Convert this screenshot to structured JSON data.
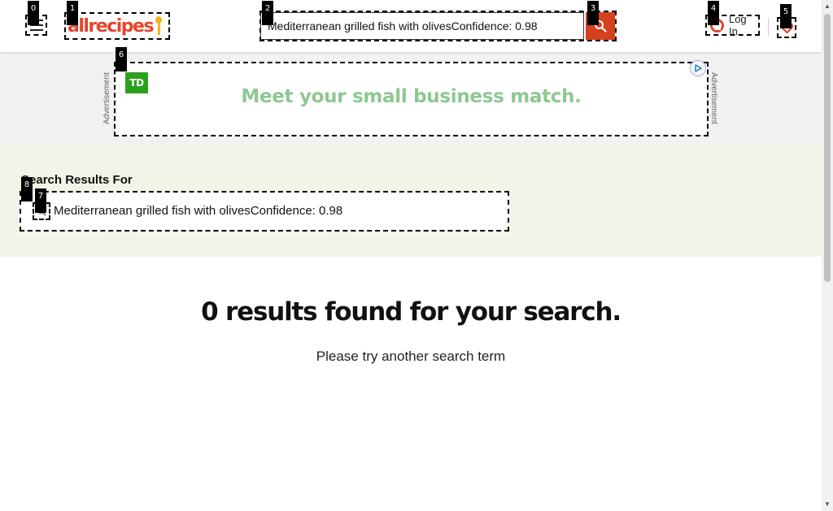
{
  "header": {
    "logo_text": "allrecipes",
    "search_value": "Mediterranean grilled fish with olivesConfidence: 0.98",
    "login_label": "Log In"
  },
  "ad": {
    "label": "Advertisement",
    "brand": "TD",
    "headline": "Meet your small business match."
  },
  "results": {
    "heading": "Search Results For",
    "query": "Mediterranean grilled fish with olivesConfidence: 0.98",
    "no_results_title": "0 results found for your search.",
    "no_results_hint": "Please try another search term"
  },
  "badges": [
    "0",
    "1",
    "2",
    "3",
    "4",
    "5",
    "6",
    "7",
    "8"
  ],
  "colors": {
    "brand_red": "#e2462d",
    "search_button": "#d5401f",
    "ad_green": "#8dc891",
    "results_band": "#f3f4e8"
  }
}
